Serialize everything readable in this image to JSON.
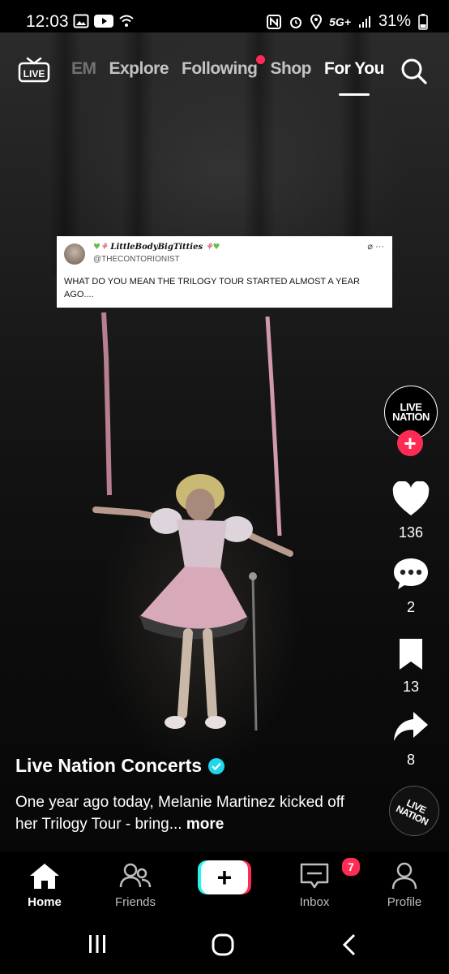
{
  "status_bar": {
    "time": "12:03",
    "network": "5G+",
    "battery": "31%",
    "left_icons": [
      "gallery-icon",
      "youtube-icon",
      "wifi-icon"
    ],
    "right_icons": [
      "nfc-icon",
      "alarm-icon",
      "location-icon",
      "signal-icon",
      "battery-icon"
    ]
  },
  "top_nav": {
    "tabs": [
      {
        "label": "EM",
        "state": "faded"
      },
      {
        "label": "Explore",
        "state": "normal"
      },
      {
        "label": "Following",
        "state": "normal",
        "has_dot": true
      },
      {
        "label": "Shop",
        "state": "normal"
      },
      {
        "label": "For You",
        "state": "active"
      }
    ],
    "live_label": "LIVE"
  },
  "tweet": {
    "display_name": "LittleBodyBigTitties",
    "handle": "@THECONTORIONIST",
    "text": "WHAT DO YOU MEAN THE TRILOGY TOUR STARTED ALMOST A YEAR AGO...."
  },
  "creator": {
    "logo_line1": "LIVE",
    "logo_line2": "NATION",
    "name": "Live Nation Concerts",
    "verified": true
  },
  "actions": {
    "likes": "136",
    "comments": "2",
    "saves": "13",
    "shares": "8"
  },
  "caption": {
    "text": "One year ago today, Melanie Martinez kicked off her Trilogy Tour - bring...",
    "more_label": "more"
  },
  "bottom_nav": {
    "home": "Home",
    "friends": "Friends",
    "inbox": "Inbox",
    "inbox_badge": "7",
    "profile": "Profile"
  },
  "colors": {
    "accent": "#fe2c55",
    "cyan": "#25f4ee",
    "verified": "#20d5ec"
  }
}
